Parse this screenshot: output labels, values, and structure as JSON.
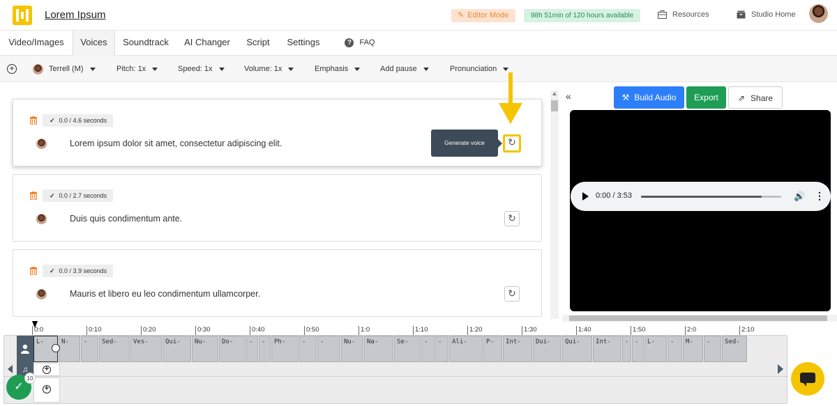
{
  "header": {
    "app_title": "Lorem Ipsum",
    "editor_mode": "Editor Mode",
    "hours_available": "98h 51min of 120 hours available",
    "resources": "Resources",
    "studio_home": "Studio Home",
    "logo_color": "#f5c400"
  },
  "tabs": [
    {
      "label": "Video/Images"
    },
    {
      "label": "Voices",
      "active": true
    },
    {
      "label": "Soundtrack"
    },
    {
      "label": "AI Changer"
    },
    {
      "label": "Script"
    },
    {
      "label": "Settings"
    },
    {
      "label": "FAQ"
    }
  ],
  "toolbar": {
    "voice": "Terrell (M)",
    "pitch": "Pitch: 1x",
    "speed": "Speed: 1x",
    "volume": "Volume: 1x",
    "emphasis": "Emphasis",
    "add_pause": "Add pause",
    "pronunciation": "Pronunciation"
  },
  "cards": [
    {
      "duration": "0.0 / 4.6 seconds",
      "text": "Lorem ipsum dolor sit amet, consectetur adipiscing elit."
    },
    {
      "duration": "0.0 / 2.7 seconds",
      "text": "Duis quis condimentum ante."
    },
    {
      "duration": "0.0 / 3.9 seconds",
      "text": "Mauris et libero eu leo condimentum ullamcorper."
    }
  ],
  "tooltip": "Generate voice",
  "actions": {
    "build_audio": "Build Audio",
    "export": "Export",
    "share": "Share"
  },
  "player": {
    "time": "0:00 / 3:53",
    "progress": 0.86
  },
  "timeline": {
    "ticks": [
      "0:0",
      "0:10",
      "0:20",
      "0:30",
      "0:40",
      "0:50",
      "1:0",
      "1:10",
      "1:20",
      "1:30",
      "1:40",
      "1:50",
      "2:0",
      "2:10"
    ],
    "segments": [
      "L-",
      "N-",
      "-",
      "Sed-",
      "Ves-",
      "Qui-",
      "Nu-",
      "Do-",
      "-",
      "-",
      "Ph-",
      "-",
      "-",
      "Nu-",
      "Na-",
      "Se-",
      "-",
      "-",
      "Ali-",
      "P-",
      "Int-",
      "Dui-",
      "Qui-",
      "Int-",
      "-",
      "-",
      "L-",
      "-",
      "M-",
      "-",
      "Sed-"
    ]
  },
  "status": {
    "count": "10"
  },
  "colors": {
    "accent": "#f5c400",
    "build": "#2d7ff9",
    "export": "#1f9d55"
  }
}
